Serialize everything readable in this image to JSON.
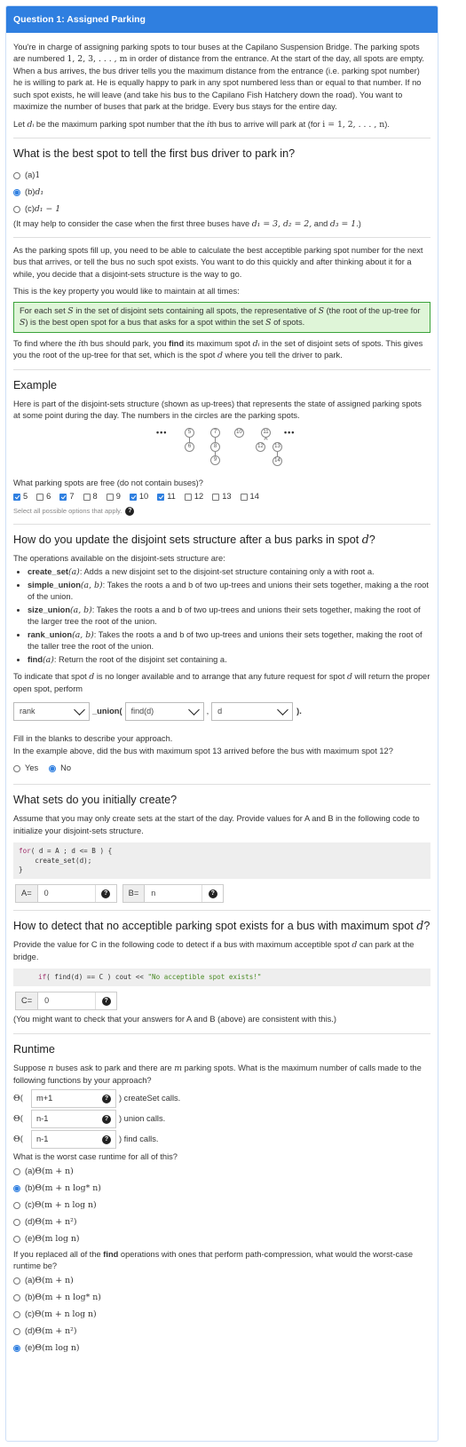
{
  "header": {
    "title": "Question 1: Assigned Parking"
  },
  "intro": {
    "p1a": "You're in charge of assigning parking spots to tour buses at the Capilano Suspension Bridge. The parking spots are numbered ",
    "p1m": "1, 2, 3, . . . , m",
    "p1b": " in order of distance from the entrance. At the start of the day, all spots are empty. When a bus arrives, the bus driver tells you the maximum distance from the entrance (i.e. parking spot number) he is willing to park at. He is equally happy to park in any spot numbered less than or equal to that number. If no such spot exists, he will leave (and take his bus to the Capilano Fish Hatchery down the road). You want to maximize the number of buses that park at the bridge. Every bus stays for the entire day.",
    "p2a": "Let ",
    "p2m1": "dᵢ",
    "p2b": " be the maximum parking spot number that the ",
    "p2m2": "i",
    "p2c": "th bus to arrive will park at (for ",
    "p2m3": "i = 1, 2, . . . , n",
    "p2d": ")."
  },
  "q1": {
    "title": "What is the best spot to tell the first bus driver to park in?",
    "options": [
      {
        "pre": "(a) ",
        "math": "1",
        "selected": false
      },
      {
        "pre": "(b) ",
        "math": "d₁",
        "selected": true
      },
      {
        "pre": "(c) ",
        "math": "d₁ − 1",
        "selected": false
      }
    ],
    "hint_a": "(It may help to consider the case when the first three buses have ",
    "hint_m": "d₁ = 3, d₂ = 2,",
    "hint_b": " and ",
    "hint_m2": "d₃ = 1",
    "hint_c": ".)"
  },
  "p3": "As the parking spots fill up, you need to be able to calculate the best acceptible parking spot number for the next bus that arrives, or tell the bus no such spot exists. You want to do this quickly and after thinking about it for a while, you decide that a disjoint-sets structure is the way to go.",
  "p4": "This is the key property you would like to maintain at all times:",
  "key": {
    "a": "For each set ",
    "m1": "S",
    "b": " in the set of disjoint sets containing all spots, the representative of ",
    "m2": "S",
    "c": " (the root of the up-tree for ",
    "m3": "S",
    "d": ") is the best open spot for a bus that asks for a spot within the set ",
    "m4": "S",
    "e": " of spots."
  },
  "p5": {
    "a": "To find where the ",
    "m1": "i",
    "b": "th bus should park, you ",
    "bold": "find",
    "c": " its maximum spot ",
    "m2": "dᵢ",
    "d": " in the set of disjoint sets of spots. This gives you the root of the up-tree for that set, which is the spot ",
    "m3": "d",
    "e": " where you tell the driver to park."
  },
  "example": {
    "title": "Example",
    "desc": "Here is part of the disjoint-sets structure (shown as up-trees) that represents the state of assigned parking spots at some point during the day. The numbers in the circles are the parking spots.",
    "dots": "•••",
    "nodes": [
      "5",
      "7",
      "10",
      "11",
      "6",
      "8",
      "9",
      "12",
      "13",
      "14"
    ],
    "question": "What parking spots are free (do not contain buses)?",
    "checkboxes": [
      {
        "label": "5",
        "checked": true
      },
      {
        "label": "6",
        "checked": false
      },
      {
        "label": "7",
        "checked": true
      },
      {
        "label": "8",
        "checked": false
      },
      {
        "label": "9",
        "checked": false
      },
      {
        "label": "10",
        "checked": true
      },
      {
        "label": "11",
        "checked": true
      },
      {
        "label": "12",
        "checked": false
      },
      {
        "label": "13",
        "checked": false
      },
      {
        "label": "14",
        "checked": false
      }
    ],
    "help_text": "Select all possible options that apply."
  },
  "q2": {
    "title_a": "How do you update the disjoint sets structure after a bus parks in spot ",
    "title_m": "d",
    "title_b": "?",
    "intro": "The operations available on the disjoint-sets structure are:",
    "ops": [
      {
        "name": "create_set",
        "args": "(a)",
        "desc": ": Adds a new disjoint set to the disjoint-set structure containing only a with root a."
      },
      {
        "name": "simple_union",
        "args": "(a, b)",
        "desc": ": Takes the roots a and b of two up-trees and unions their sets together, making a the root of the union."
      },
      {
        "name": "size_union",
        "args": "(a, b)",
        "desc": ": Takes the roots a and b of two up-trees and unions their sets together, making the root of the larger tree the root of the union."
      },
      {
        "name": "rank_union",
        "args": "(a, b)",
        "desc": ": Takes the roots a and b of two up-trees and unions their sets together, making the root of the taller tree the root of the union."
      },
      {
        "name": "find",
        "args": "(a)",
        "desc": ": Return the root of the disjoint set containing a."
      }
    ],
    "indicate_a": "To indicate that spot ",
    "indicate_m": "d",
    "indicate_b": " is no longer available and to arrange that any future request for spot ",
    "indicate_m2": "d",
    "indicate_c": " will return the proper open spot, perform",
    "select1": "rank",
    "union_text": "_union(",
    "select2": "find(d)",
    "comma": ",",
    "select3": "d",
    "close": ").",
    "fill": "Fill in the blanks to describe your approach.",
    "order_q": "In the example above, did the bus with maximum spot 13 arrived before the bus with maximum spot 12?",
    "yes": "Yes",
    "no": "No"
  },
  "q3": {
    "title": "What sets do you initially create?",
    "desc": "Assume that you may only create sets at the start of the day. Provide values for A and B in the following code to initialize your disjoint-sets structure.",
    "code_l1a": "for",
    "code_l1b": "( d = A ; d <= B ) {",
    "code_l2": "    create_set(d);",
    "code_l3": "}",
    "a_label": "A=",
    "a_val": "0",
    "b_label": "B=",
    "b_val": "n"
  },
  "q4": {
    "title_a": "How to detect that no acceptible parking spot exists for a bus with maximum spot ",
    "title_m": "d",
    "title_b": "?",
    "desc_a": "Provide the value for C in the following code to detect if a bus with maximum acceptible spot ",
    "desc_m": "d",
    "desc_b": " can park at the bridge.",
    "code_kw": "if",
    "code_a": "( find(d) == C ) cout << ",
    "code_str": "\"No acceptible spot exists!\"",
    "c_label": "C=",
    "c_val": "0",
    "note": "(You might want to check that your answers for A and B (above) are consistent with this.)"
  },
  "q5": {
    "title": "Runtime",
    "desc_a": "Suppose ",
    "desc_m1": "n",
    "desc_b": " buses ask to park and there are ",
    "desc_m2": "m",
    "desc_c": " parking spots. What is the maximum number of calls made to the following functions by your approach?",
    "theta": "Θ(",
    "rows": [
      {
        "val": "m+1",
        "suffix": ") createSet calls."
      },
      {
        "val": "n-1",
        "suffix": ") union calls."
      },
      {
        "val": "n-1",
        "suffix": ") find calls."
      }
    ],
    "worst_q": "What is the worst case runtime for all of this?",
    "worst_opts": [
      {
        "pre": "(a) ",
        "math": "Θ(m + n)",
        "selected": false
      },
      {
        "pre": "(b) ",
        "math": "Θ(m + n log* n)",
        "selected": true
      },
      {
        "pre": "(c) ",
        "math": "Θ(m + n log n)",
        "selected": false
      },
      {
        "pre": "(d) ",
        "math": "Θ(m + n²)",
        "selected": false
      },
      {
        "pre": "(e) ",
        "math": "Θ(m log n)",
        "selected": false
      }
    ],
    "pc_a": "If you replaced all of the ",
    "pc_bold": "find",
    "pc_b": " operations with ones that perform path-compression, what would the worst-case runtime be?",
    "pc_opts": [
      {
        "pre": "(a) ",
        "math": "Θ(m + n)",
        "selected": false
      },
      {
        "pre": "(b) ",
        "math": "Θ(m + n log* n)",
        "selected": false
      },
      {
        "pre": "(c) ",
        "math": "Θ(m + n log n)",
        "selected": false
      },
      {
        "pre": "(d) ",
        "math": "Θ(m + n²)",
        "selected": false
      },
      {
        "pre": "(e) ",
        "math": "Θ(m log n)",
        "selected": true
      }
    ]
  },
  "help_icon": "?"
}
